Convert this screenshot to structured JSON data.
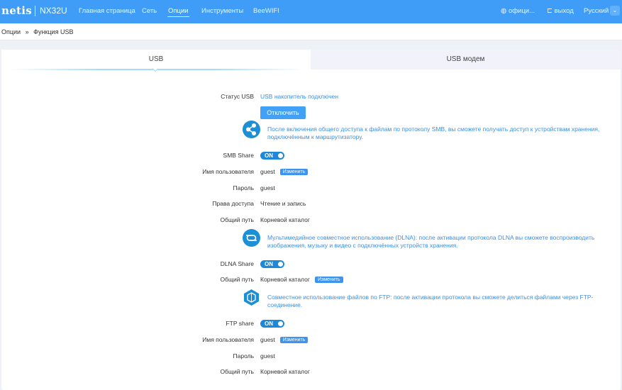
{
  "header": {
    "logo": "netis",
    "model": "NX32U",
    "nav": [
      "Главная страница",
      "Сеть",
      "Опции",
      "Инструменты",
      "BeeWIFI"
    ],
    "active_nav": "Опции",
    "official": "офици...",
    "logout": "выход",
    "language": "Русский"
  },
  "breadcrumb": {
    "parent": "Опции",
    "separator": "»",
    "current": "Функция USB"
  },
  "tabs": [
    "USB",
    "USB модем"
  ],
  "usb": {
    "status_label": "Статус USB",
    "status_value": "USB накопитель подключен",
    "disconnect_button": "Отключить",
    "smb_info": "После включения общего доступа к файлам по протоколу SMB, вы сможете получать доступ к устройствам хранения, подключённым к маршрутизатору.",
    "smb_label": "SMB Share",
    "smb_toggle": "ON",
    "user_label": "Имя пользователя",
    "user_value": "guest",
    "change": "Изменить",
    "pass_label": "Пароль",
    "pass_value": "guest",
    "rights_label": "Права доступа",
    "rights_value": "Чтение и запись",
    "path_label": "Общий путь",
    "path_value": "Корневой каталог",
    "dlna_info": "Мультимедийное совместное использование (DLNA): после активации протокола DLNA вы сможете воспроизводить изображения, музыку и видео с подключённых устройств хранения.",
    "dlna_label": "DLNA Share",
    "dlna_toggle": "ON",
    "dlna_path_label": "Общий путь",
    "dlna_path_value": "Корневой каталог",
    "ftp_info": "Совместное использование файлов по FTP: после активации протокола вы сможете делиться файлами через FTP-соединение.",
    "ftp_label": "FTP share",
    "ftp_toggle": "ON",
    "ftp_user_label": "Имя пользователя",
    "ftp_user_value": "guest",
    "ftp_pass_label": "Пароль",
    "ftp_pass_value": "guest",
    "ftp_path_label": "Общий путь",
    "ftp_path_value": "Корневой каталог"
  }
}
